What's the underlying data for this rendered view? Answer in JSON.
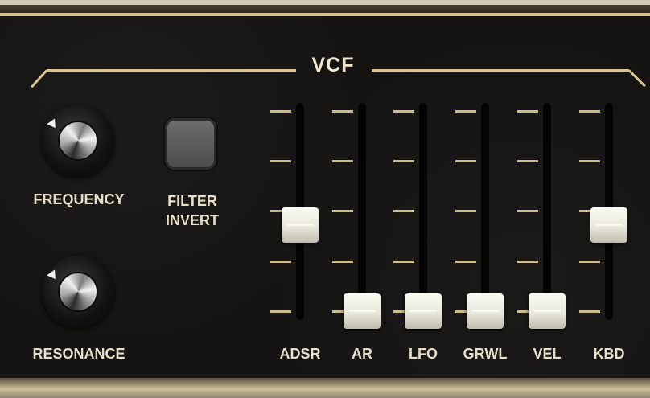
{
  "vcf": {
    "title": "VCF",
    "knobs": [
      {
        "label": "FREQUENCY"
      },
      {
        "label": "RESONANCE"
      }
    ],
    "filter_invert": {
      "label_line1": "FILTER",
      "label_line2": "INVERT"
    },
    "sliders": [
      {
        "label": "ADSR",
        "value": 0.5
      },
      {
        "label": "AR",
        "value": 0.0
      },
      {
        "label": "LFO",
        "value": 0.0
      },
      {
        "label": "GRWL",
        "value": 0.0
      },
      {
        "label": "VEL",
        "value": 0.0
      },
      {
        "label": "KBD",
        "value": 0.5
      }
    ]
  }
}
